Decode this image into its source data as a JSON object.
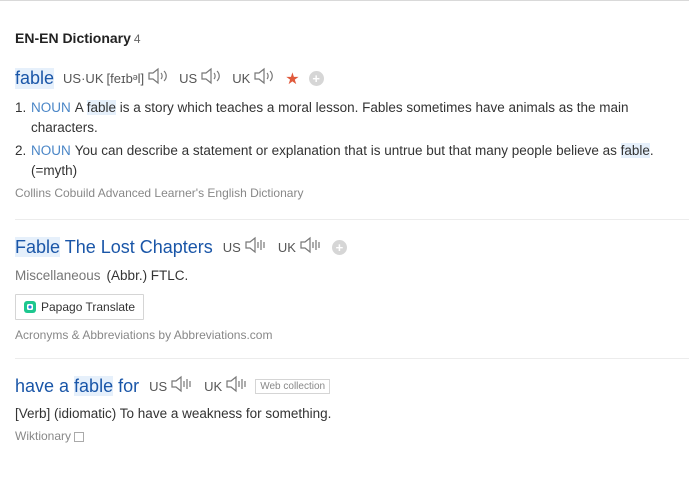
{
  "header": {
    "title": "EN-EN Dictionary",
    "count": "4"
  },
  "entry1": {
    "word": "fable",
    "pron_label": "US·UK",
    "pron_text": "[feɪbᵊl]",
    "us_label": "US",
    "uk_label": "UK",
    "definitions": [
      {
        "num": "1.",
        "pos": "NOUN",
        "pre": "A ",
        "hl": "fable",
        "post": " is a story which teaches a moral lesson. Fables sometimes have animals as the main",
        "cont": "characters."
      },
      {
        "num": "2.",
        "pos": "NOUN",
        "pre": "You can describe a statement or explanation that is untrue but that many people believe as ",
        "hl": "fable",
        "post": ".",
        "cont": "(=myth)"
      }
    ],
    "source": "Collins Cobuild Advanced Learner's English Dictionary"
  },
  "entry2": {
    "word_hl": "Fable",
    "word_rest": " The Lost Chapters",
    "us_label": "US",
    "uk_label": "UK",
    "category": "Miscellaneous",
    "abbr": "(Abbr.) FTLC.",
    "papago": "Papago Translate",
    "source": "Acronyms & Abbreviations by Abbreviations.com"
  },
  "entry3": {
    "pre": "have a ",
    "hl": "fable",
    "post": " for",
    "us_label": "US",
    "uk_label": "UK",
    "tag": "Web collection",
    "definition": "[Verb] (idiomatic) To have a weakness for something.",
    "source": "Wiktionary"
  },
  "icons": {
    "speaker": "speaker-icon",
    "star": "star-icon",
    "add": "plus-icon",
    "external": "external-link-icon"
  },
  "colors": {
    "headword": "#1a56a8",
    "highlight": "#e6f0fb",
    "pos": "#4a86c7",
    "star": "#e05a3c"
  }
}
